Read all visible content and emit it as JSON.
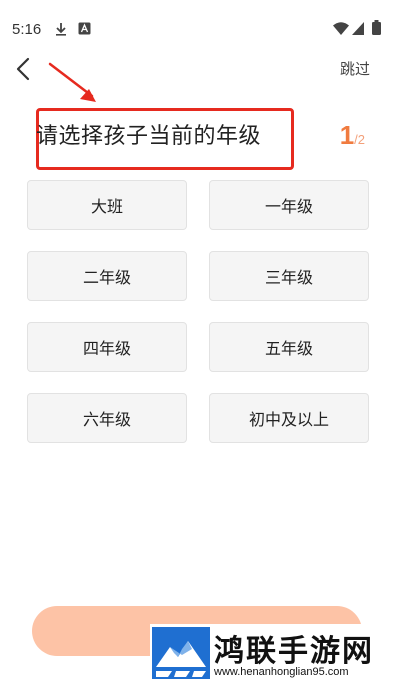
{
  "status_bar": {
    "time": "5:16",
    "left_icons": [
      "download-icon",
      "a-box-icon"
    ],
    "right_icons": [
      "wifi-icon",
      "signal-icon",
      "battery-icon"
    ]
  },
  "nav": {
    "back_icon": "chevron-left-icon",
    "skip_label": "跳过"
  },
  "title": "请选择孩子当前的年级",
  "step": {
    "current": "1",
    "total": "/2"
  },
  "grades": [
    {
      "label": "大班"
    },
    {
      "label": "一年级"
    },
    {
      "label": "二年级"
    },
    {
      "label": "三年级"
    },
    {
      "label": "四年级"
    },
    {
      "label": "五年级"
    },
    {
      "label": "六年级"
    },
    {
      "label": "初中及以上"
    }
  ],
  "annotation": {
    "color": "#e62a1f"
  },
  "colors": {
    "accent": "#f07b3f",
    "next_button": "#fdc3a6",
    "option_bg": "#f5f5f5"
  },
  "watermark": {
    "brand": "鸿联手游网",
    "url": "www.henanhonglian95.com"
  }
}
